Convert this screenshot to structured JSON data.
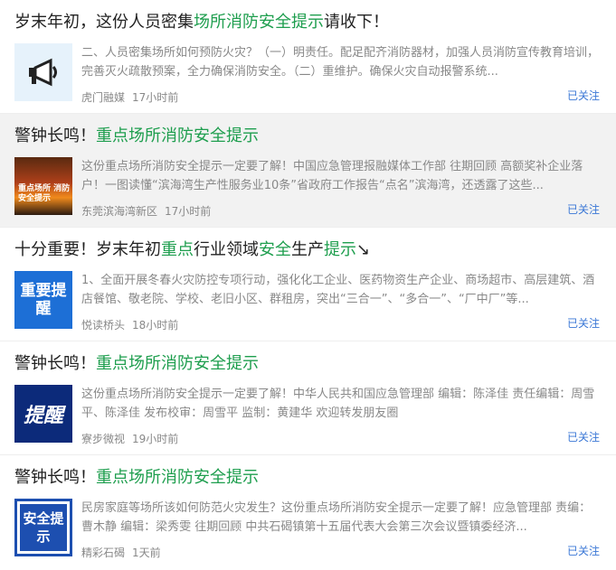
{
  "items": [
    {
      "title_parts": [
        {
          "t": "岁末年初，这份人员密集",
          "hl": false
        },
        {
          "t": "场所消防安全提示",
          "hl": true
        },
        {
          "t": "请收下！",
          "hl": false
        }
      ],
      "snippet": "二、人员密集场所如何预防火灾？（一）明责任。配足配齐消防器材，加强人员消防宣传教育培训，完善灭火疏散预案，全力确保消防安全。（二）重维护。确保火灾自动报警系统...",
      "source": "虎门融媒",
      "time": "17小时前",
      "follow": "已关注",
      "thumb_icon": "megaphone-icon"
    },
    {
      "title_parts": [
        {
          "t": "警钟长鸣！",
          "hl": false
        },
        {
          "t": "重点场所消防安全提示",
          "hl": true
        }
      ],
      "snippet": "这份重点场所消防安全提示一定要了解！中国应急管理报融媒体工作部 往期回顾 高额奖补企业落户！一图读懂“滨海湾生产性服务业10条”省政府工作报告“点名”滨海湾，还透露了这些...",
      "source": "东莞滨海湾新区",
      "time": "17小时前",
      "follow": "已关注",
      "thumb_caption": "重点场所 消防安全提示"
    },
    {
      "title_parts": [
        {
          "t": "十分重要！岁末年初",
          "hl": false
        },
        {
          "t": "重点",
          "hl": true
        },
        {
          "t": "行业领域",
          "hl": false
        },
        {
          "t": "安全",
          "hl": true
        },
        {
          "t": "生产",
          "hl": false
        },
        {
          "t": "提示",
          "hl": true
        },
        {
          "t": "↘",
          "hl": false
        }
      ],
      "snippet": "1、全面开展冬春火灾防控专项行动，强化化工企业、医药物资生产企业、商场超市、高层建筑、酒店餐馆、敬老院、学校、老旧小区、群租房，突出“三合一”、“多合一”、“厂中厂”等...",
      "source": "悦读桥头",
      "time": "18小时前",
      "follow": "已关注",
      "thumb_text": "重要提醒"
    },
    {
      "title_parts": [
        {
          "t": "警钟长鸣！",
          "hl": false
        },
        {
          "t": "重点场所消防安全提示",
          "hl": true
        }
      ],
      "snippet": "这份重点场所消防安全提示一定要了解！中华人民共和国应急管理部 编辑：陈泽佳 责任编辑：周雪平、陈泽佳 发布校审：周雪平 监制：黄建华 欢迎转发朋友圈",
      "source": "寮步微视",
      "time": "19小时前",
      "follow": "已关注",
      "thumb_text": "提醒"
    },
    {
      "title_parts": [
        {
          "t": "警钟长鸣！",
          "hl": false
        },
        {
          "t": "重点场所消防安全提示",
          "hl": true
        }
      ],
      "snippet": "民房家庭等场所该如何防范火灾发生？这份重点场所消防安全提示一定要了解！应急管理部 责编：曹木静 编辑：梁秀雯 往期回顾 中共石碣镇第十五届代表大会第三次会议暨镇委经济...",
      "source": "精彩石碣",
      "time": "1天前",
      "follow": "已关注",
      "thumb_text": "安全提示"
    }
  ],
  "colors": {
    "highlight": "#1e9e4e",
    "follow": "#3a77d6",
    "hover_bg": "#f2f2f2"
  }
}
